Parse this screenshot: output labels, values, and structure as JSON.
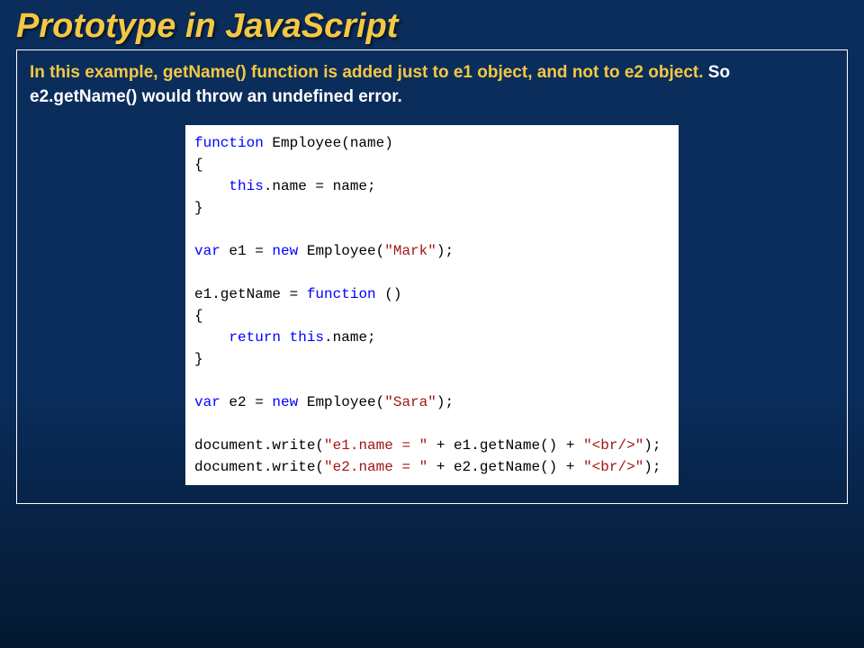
{
  "title": "Prototype in JavaScript",
  "description": {
    "highlight": "In this example, getName() function is added just to e1 object, and not to e2 object. ",
    "rest": "So e2.getName() would throw an undefined error."
  },
  "code": {
    "l1_kw": "function",
    "l1_rest": " Employee(name)",
    "l2": "{",
    "l3_a": "    ",
    "l3_kw": "this",
    "l3_b": ".name = name;",
    "l4": "}",
    "l5": "",
    "l6_kw1": "var",
    "l6_a": " e1 = ",
    "l6_kw2": "new",
    "l6_b": " Employee(",
    "l6_str": "\"Mark\"",
    "l6_c": ");",
    "l7": "",
    "l8_a": "e1.getName = ",
    "l8_kw": "function",
    "l8_b": " ()",
    "l9": "{",
    "l10_a": "    ",
    "l10_kw1": "return",
    "l10_b": " ",
    "l10_kw2": "this",
    "l10_c": ".name;",
    "l11": "}",
    "l12": "",
    "l13_kw1": "var",
    "l13_a": " e2 = ",
    "l13_kw2": "new",
    "l13_b": " Employee(",
    "l13_str": "\"Sara\"",
    "l13_c": ");",
    "l14": "",
    "l15_a": "document.write(",
    "l15_str1": "\"e1.name = \"",
    "l15_b": " + e1.getName() + ",
    "l15_str2": "\"<br/>\"",
    "l15_c": ");",
    "l16_a": "document.write(",
    "l16_str1": "\"e2.name = \"",
    "l16_b": " + e2.getName() + ",
    "l16_str2": "\"<br/>\"",
    "l16_c": ");"
  }
}
